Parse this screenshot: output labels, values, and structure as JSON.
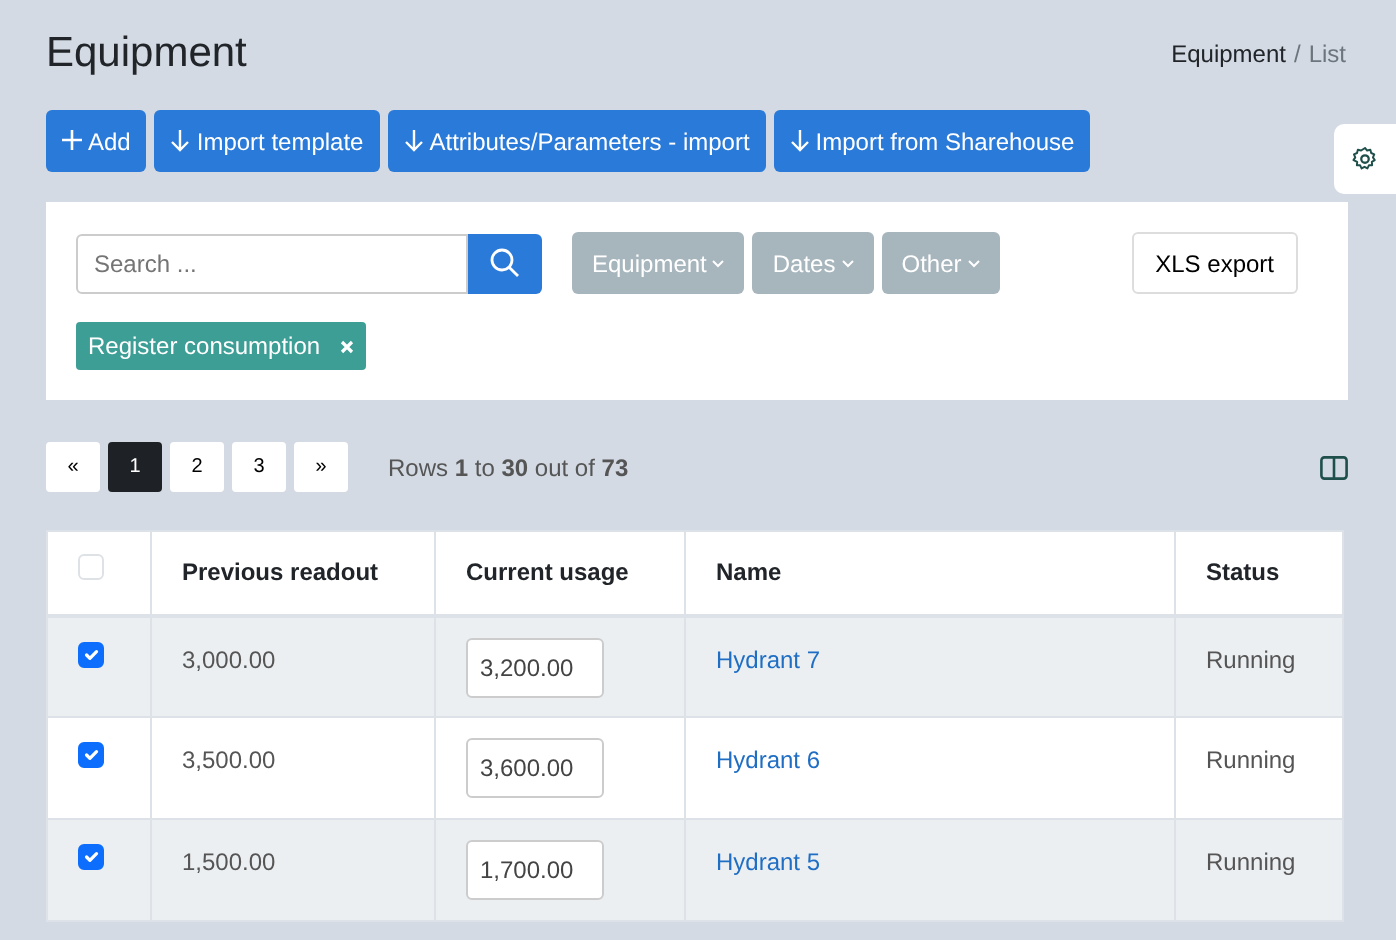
{
  "title": "Equipment",
  "breadcrumb": [
    {
      "label": "Equipment",
      "current": false
    },
    {
      "label": "List",
      "current": true
    }
  ],
  "breadcrumb_separator": "/",
  "actions": [
    {
      "label": "Add",
      "kind": "add"
    },
    {
      "label": "Import template",
      "kind": "import"
    },
    {
      "label": "Attributes/Parameters - import",
      "kind": "import"
    },
    {
      "label": "Import from Sharehouse",
      "kind": "import"
    }
  ],
  "search": {
    "placeholder": "Search ..."
  },
  "filters": [
    "Equipment",
    "Dates",
    "Other"
  ],
  "export_button": "XLS export",
  "active_filters": [
    "Register consumption"
  ],
  "pagination": [
    {
      "label": "«",
      "selected": false
    },
    {
      "label": "1",
      "selected": true
    },
    {
      "label": "2",
      "selected": false
    },
    {
      "label": "3",
      "selected": false
    },
    {
      "label": "»",
      "selected": false
    }
  ],
  "rows_info": "Rows **1** to **30** out of **73**",
  "table": {
    "select_all_checked": false,
    "columns": [
      "Previous readout",
      "Current usage",
      "Name",
      "Status"
    ],
    "rows": [
      {
        "checked": true,
        "previous_readout": "3,000.00",
        "current_usage": "3,200.00",
        "name": "Hydrant 7",
        "status": "Running"
      },
      {
        "checked": true,
        "previous_readout": "3,500.00",
        "current_usage": "3,600.00",
        "name": "Hydrant 6",
        "status": "Running"
      },
      {
        "checked": true,
        "previous_readout": "1,500.00",
        "current_usage": "1,700.00",
        "name": "Hydrant 5",
        "status": "Running"
      }
    ]
  }
}
